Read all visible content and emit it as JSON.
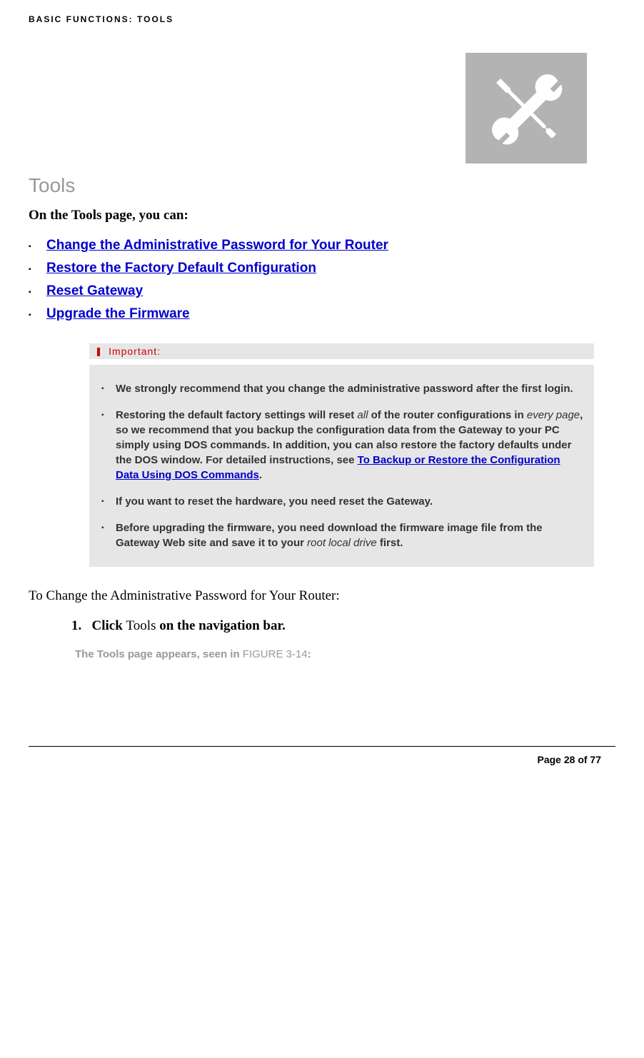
{
  "header": {
    "breadcrumb": "BASIC FUNCTIONS: TOOLS"
  },
  "section": {
    "title": "Tools",
    "intro": "On the Tools page, you can:"
  },
  "links": {
    "change_password": "Change the Administrative Password for Your Router",
    "restore_factory": "Restore the Factory Default Configuration",
    "reset_gateway": "Reset Gateway",
    "upgrade_firmware": "Upgrade the Firmware"
  },
  "important": {
    "label": "Important:",
    "item1": "We strongly recommend that you change the administrative password after the first login.",
    "item2_part1": "Restoring the default factory settings will reset ",
    "item2_all": "all",
    "item2_part2": " of the router configurations in ",
    "item2_everypage": "every page",
    "item2_part3": ", so we recommend that you backup the configuration data from the Gateway to your PC simply using DOS commands. In addition, you can also restore the factory defaults under the DOS window. For detailed instructions, see ",
    "item2_link": "To Backup or Restore the Configuration Data Using DOS Commands",
    "item2_end": ".",
    "item3": "If you want to reset the hardware, you need reset the Gateway.",
    "item4_part1": "Before upgrading the firmware, you need download the firmware image file from the Gateway Web site and save it to your ",
    "item4_root": "root local drive",
    "item4_end": " first."
  },
  "steps": {
    "subsection": "To Change the Administrative Password for Your Router:",
    "step1_num": "1.",
    "step1_bold1": "Click ",
    "step1_normal": "Tools",
    "step1_bold2": " on the navigation bar.",
    "result_part1": "The Tools page appears, seen in ",
    "result_figure": "FIGURE 3-14",
    "result_end": ":"
  },
  "footer": {
    "page": "Page 28 of 77"
  }
}
